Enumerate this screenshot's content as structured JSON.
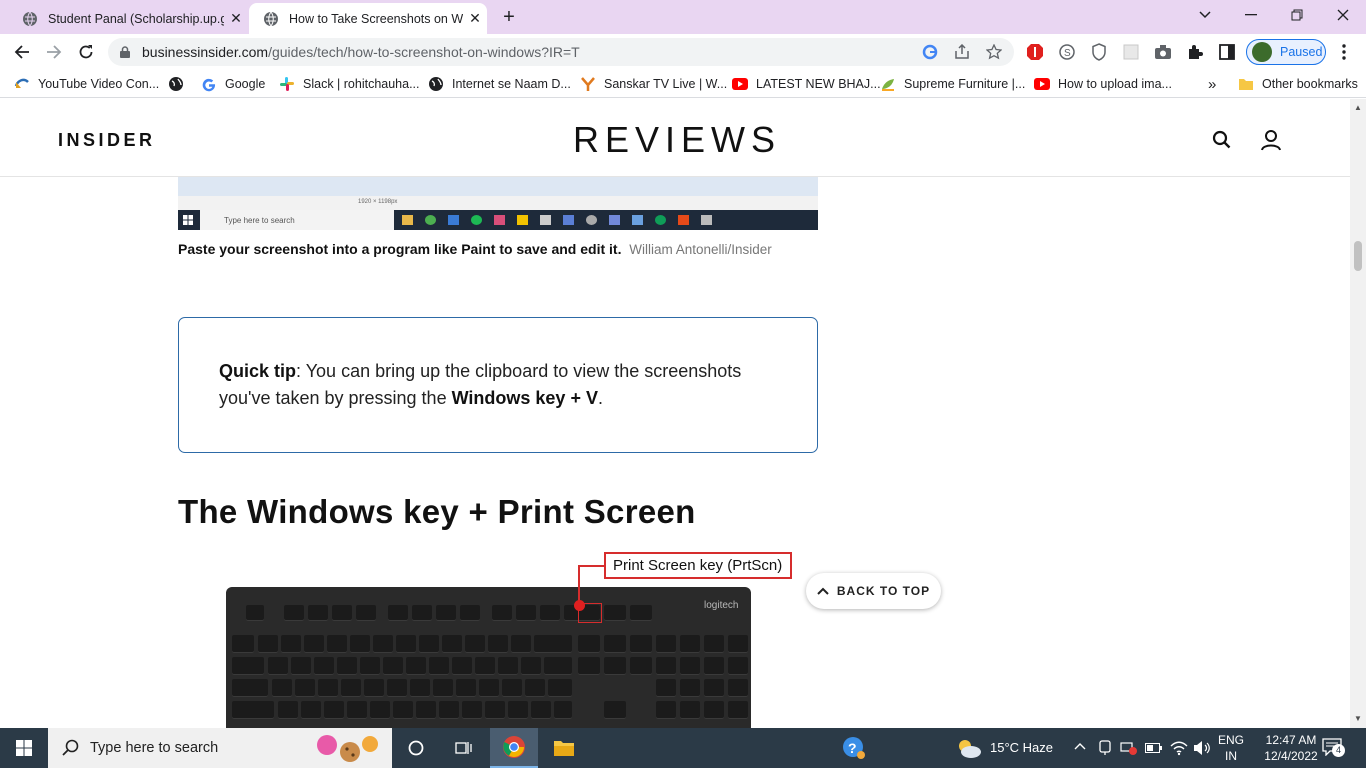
{
  "browser": {
    "tabs": [
      {
        "title": "Student Panal (Scholarship.up.go",
        "active": false
      },
      {
        "title": "How to Take Screenshots on Win",
        "active": true
      }
    ],
    "new_tab_label": "+",
    "url_host": "businessinsider.com",
    "url_path": "/guides/tech/how-to-screenshot-on-windows?IR=T",
    "profile_label": "Paused",
    "bookmarks": [
      "YouTube Video Con...",
      "",
      "Google",
      "Slack | rohitchauha...",
      "Internet se Naam D...",
      "Sanskar TV Live | W...",
      "LATEST NEW BHAJ...",
      "Supreme Furniture |...",
      "How to upload ima..."
    ],
    "bookmarks_overflow": "»",
    "other_bookmarks": "Other bookmarks"
  },
  "site": {
    "left_logo": "INSIDER",
    "center_logo": "REVIEWS"
  },
  "article": {
    "image_taskbar_search": "Type here to search",
    "image_status_text": "1920 × 1198px",
    "caption_bold": "Paste your screenshot into a program like Paint to save and edit it.",
    "caption_credit": "William Antonelli/Insider",
    "tip": {
      "label": "Quick tip",
      "text_before": ": You can bring up the clipboard to view the screenshots you've taken by pressing the ",
      "bold_keys": "Windows key + V",
      "text_after": "."
    },
    "heading": "The Windows key + Print Screen",
    "callout_label": "Print Screen key (PrtScn)",
    "keyboard_brand": "logitech",
    "back_to_top": "BACK TO TOP"
  },
  "taskbar": {
    "search_placeholder": "Type here to search",
    "weather": "15°C  Haze",
    "lang_line1": "ENG",
    "lang_line2": "IN",
    "time": "12:47 AM",
    "date": "12/4/2022",
    "notification_count": "4"
  },
  "colors": {
    "tabstrip_bg": "#e9d6f2",
    "tip_border": "#2d6aa7",
    "callout_red": "#d62d2d",
    "taskbar_bg": "#2b3a47"
  }
}
